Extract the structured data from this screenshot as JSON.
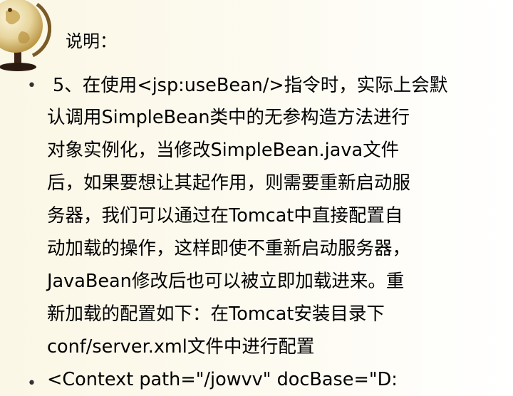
{
  "slide": {
    "title": "说明：",
    "paragraph_lines": [
      "5、在使用<jsp:useBean/>指令时，实际上会默",
      "认调用SimpleBean类中的无参构造方法进行",
      "对象实例化，当修改SimpleBean.java文件",
      "后，如果要想让其起作用，则需要重新启动服",
      "务器，我们可以通过在Tomcat中直接配置自",
      "动加载的操作，这样即使不重新启动服务器，",
      "JavaBean修改后也可以被立即加载进来。重",
      "新加载的配置如下：在Tomcat安装目录下",
      "conf/server.xml文件中进行配置"
    ],
    "second_bullet_text": "<Context path=\"/jowvv\" docBase=\"D:",
    "bullet_char": "•"
  },
  "colors": {
    "background_left": "#fbf7e6",
    "background_right": "#ffffff",
    "globe_gold": "#c9a44a",
    "globe_light": "#f2e7bf",
    "stand_dark": "#3a2415"
  },
  "icons": {
    "decoration": "globe-icon"
  }
}
